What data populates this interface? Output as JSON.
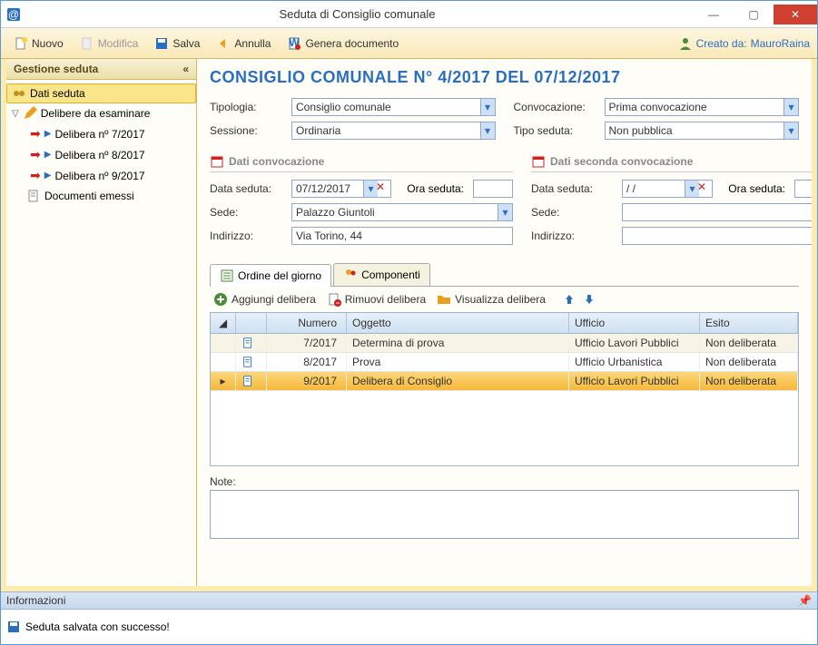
{
  "window": {
    "title": "Seduta di Consiglio comunale"
  },
  "toolbar": {
    "nuovo": "Nuovo",
    "modifica": "Modifica",
    "salva": "Salva",
    "annulla": "Annulla",
    "genera": "Genera documento",
    "created_by_label": "Creato da:",
    "created_by_user": "MauroRaina"
  },
  "sidebar": {
    "header": "Gestione seduta",
    "items": {
      "dati_seduta": "Dati seduta",
      "delibere_esaminare": "Delibere da esaminare",
      "delibere": [
        {
          "label": "Delibera nº 7/2017"
        },
        {
          "label": "Delibera nº 8/2017"
        },
        {
          "label": "Delibera nº 9/2017"
        }
      ],
      "documenti_emessi": "Documenti emessi"
    }
  },
  "main": {
    "title": "CONSIGLIO COMUNALE N° 4/2017 DEL 07/12/2017",
    "labels": {
      "tipologia": "Tipologia:",
      "sessione": "Sessione:",
      "convocazione": "Convocazione:",
      "tipo_seduta": "Tipo seduta:",
      "dati_conv": "Dati convocazione",
      "dati_conv2": "Dati seconda convocazione",
      "data_seduta": "Data seduta:",
      "ora_seduta": "Ora seduta:",
      "sede": "Sede:",
      "indirizzo": "Indirizzo:",
      "note": "Note:"
    },
    "values": {
      "tipologia": "Consiglio comunale",
      "sessione": "Ordinaria",
      "convocazione": "Prima convocazione",
      "tipo_seduta": "Non pubblica",
      "data_seduta1": "07/12/2017",
      "ora_seduta1": "",
      "sede1": "Palazzo Giuntoli",
      "indirizzo1": "Via Torino, 44",
      "data_seduta2": "/  /",
      "ora_seduta2": "",
      "sede2": "",
      "indirizzo2": ""
    },
    "tabs": {
      "ordine": "Ordine del giorno",
      "componenti": "Componenti"
    },
    "tab_toolbar": {
      "aggiungi": "Aggiungi delibera",
      "rimuovi": "Rimuovi delibera",
      "visualizza": "Visualizza delibera"
    },
    "grid": {
      "headers": {
        "numero": "Numero",
        "oggetto": "Oggetto",
        "ufficio": "Ufficio",
        "esito": "Esito"
      },
      "rows": [
        {
          "numero": "7/2017",
          "oggetto": "Determina di prova",
          "ufficio": "Ufficio Lavori Pubblici",
          "esito": "Non deliberata",
          "selected": false
        },
        {
          "numero": "8/2017",
          "oggetto": "Prova",
          "ufficio": "Ufficio Urbanistica",
          "esito": "Non deliberata",
          "selected": false
        },
        {
          "numero": "9/2017",
          "oggetto": "Delibera di Consiglio",
          "ufficio": "Ufficio Lavori Pubblici",
          "esito": "Non deliberata",
          "selected": true
        }
      ]
    }
  },
  "status": {
    "header": "Informazioni",
    "message": "Seduta salvata con successo!"
  }
}
